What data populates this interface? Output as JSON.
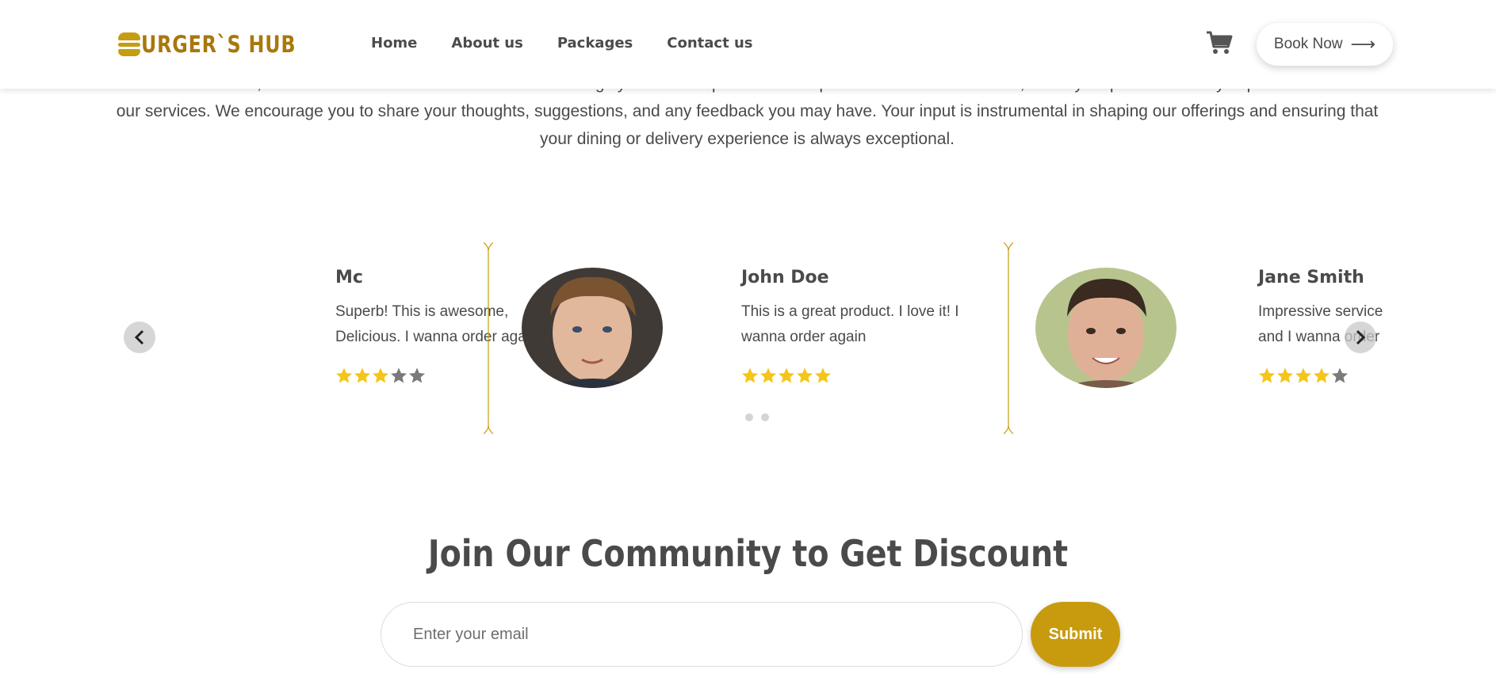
{
  "header": {
    "logo_text": "URGER`S HUB",
    "nav": [
      {
        "label": "Home"
      },
      {
        "label": "About us"
      },
      {
        "label": "Packages"
      },
      {
        "label": "Contact us"
      }
    ],
    "cart_icon": "cart-icon",
    "book_label": "Book Now",
    "book_icon": "arrow-right-icon"
  },
  "intro": {
    "text": "At our establishment, customer feedback is invaluable to us. We highly value the opinions and experiences of our customers, as they help us continually improve and enhance our services. We encourage you to share your thoughts, suggestions, and any feedback you may have. Your input is instrumental in shaping our offerings and ensuring that your dining or delivery experience is always exceptional."
  },
  "testimonials": [
    {
      "name": "Mc",
      "text": "Superb! This is awesome, Delicious. I wanna order again",
      "rating": 3
    },
    {
      "name": "John Doe",
      "text": "This is a great product. I love it! I wanna order again",
      "rating": 5
    },
    {
      "name": "Jane Smith",
      "text": "Impressive service and I wanna order again",
      "rating": 4
    }
  ],
  "slider": {
    "prev_icon": "chevron-left-icon",
    "next_icon": "chevron-right-icon",
    "dot_count": 2
  },
  "colors": {
    "brand": "#c89b0f",
    "star_filled": "#f5c518",
    "star_empty": "#7a7a7a",
    "text": "#4a4a4a"
  },
  "community": {
    "title": "Join Our Community to Get Discount",
    "email_placeholder": "Enter your email",
    "submit_label": "Submit"
  }
}
